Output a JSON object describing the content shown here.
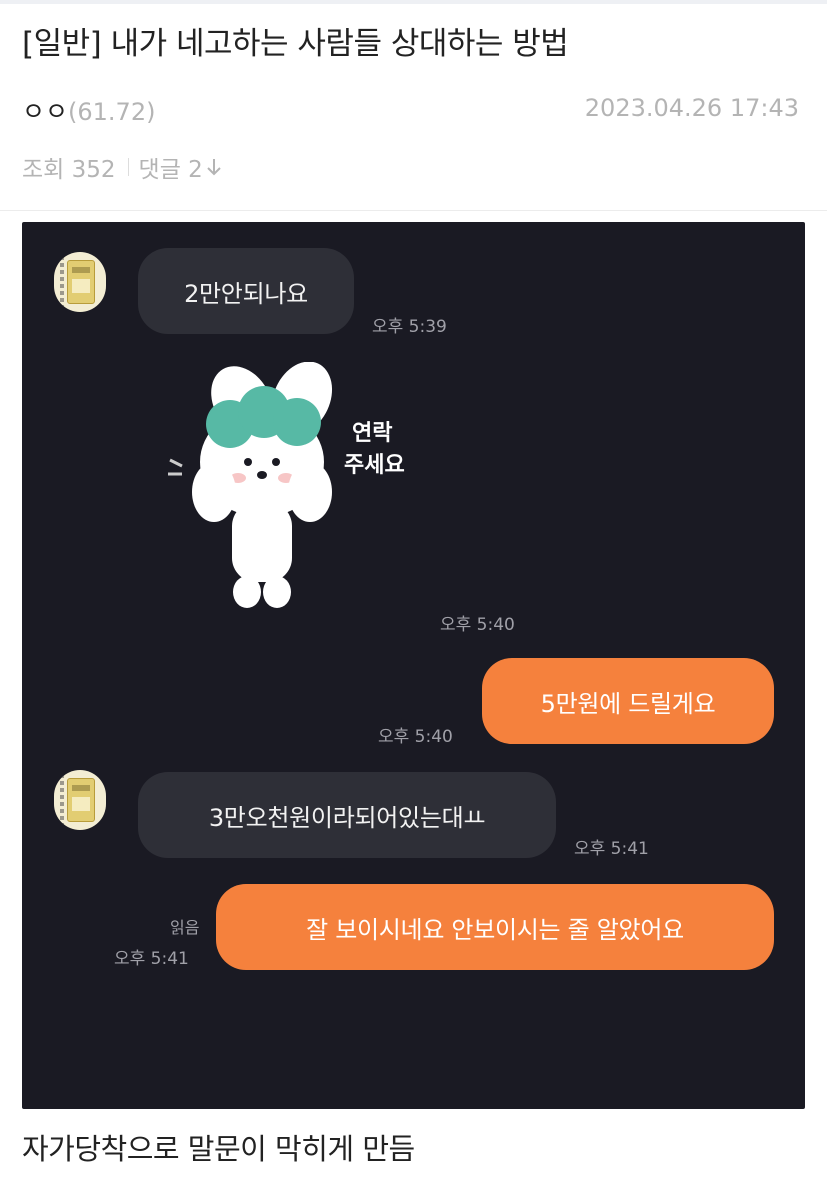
{
  "post": {
    "title": "[일반] 내가 네고하는 사람들 상대하는 방법",
    "author": "ㅇㅇ",
    "author_ip": "(61.72)",
    "date": "2023.04.26 17:43",
    "views_label": "조회 352",
    "comments_label": "댓글 2",
    "caption": "자가당착으로 말문이 막히게 만듬"
  },
  "chat": {
    "messages": [
      {
        "side": "in",
        "text": "2만안되나요",
        "time": "오후 5:39"
      },
      {
        "side": "in",
        "type": "sticker",
        "sticker_text_1": "연락",
        "sticker_text_2": "주세요",
        "time": "오후 5:40"
      },
      {
        "side": "out",
        "text": "5만원에 드릴게요",
        "time": "오후 5:40"
      },
      {
        "side": "in",
        "text": "3만오천원이라되어있는대ㅛ",
        "time": "오후 5:41"
      },
      {
        "side": "out",
        "text": "잘 보이시네요 안보이시는 줄 알았어요",
        "time": "오후 5:41",
        "read": "읽음"
      }
    ],
    "colors": {
      "background": "#1a1a23",
      "incoming": "#2e2f37",
      "outgoing": "#f5813d"
    }
  }
}
